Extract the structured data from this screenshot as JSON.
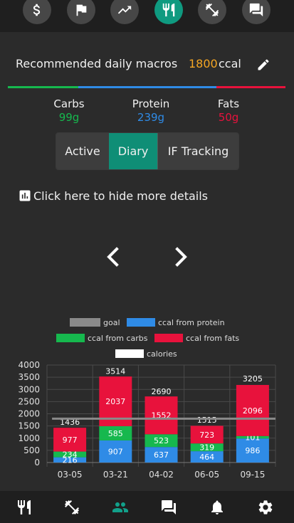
{
  "top_nav": {
    "icons": [
      "dollar-icon",
      "flag-icon",
      "trend-up-icon",
      "fork-knife-icon",
      "dumbbell-icon",
      "chat-icon"
    ],
    "active_index": 3
  },
  "macros": {
    "title": "Recommended daily macros",
    "value": "1800",
    "unit": "ccal"
  },
  "colors": {
    "green": "#16b84e",
    "blue": "#2f8be6",
    "red": "#e8123c",
    "orange": "#f5a623",
    "teal": "#0f8e76"
  },
  "macro_breakdown": [
    {
      "label": "Carbs",
      "value": "99g",
      "color": "#16b84e"
    },
    {
      "label": "Protein",
      "value": "239g",
      "color": "#2f8be6"
    },
    {
      "label": "Fats",
      "value": "50g",
      "color": "#e8123c"
    }
  ],
  "tabs": [
    {
      "label": "Active",
      "selected": false
    },
    {
      "label": "Diary",
      "selected": true
    },
    {
      "label": "IF Tracking",
      "selected": false
    }
  ],
  "details_toggle": {
    "icon": "bar-chart-icon",
    "label": "Click here to hide more details"
  },
  "chart_data": {
    "type": "bar",
    "stacked": true,
    "categories": [
      "03-05",
      "03-21",
      "04-02",
      "06-05",
      "09-15"
    ],
    "series": [
      {
        "name": "ccal from protein",
        "color": "#2f8be6",
        "values": [
          216,
          907,
          637,
          464,
          986
        ]
      },
      {
        "name": "ccal from carbs",
        "color": "#16b84e",
        "values": [
          234,
          585,
          523,
          319,
          101
        ]
      },
      {
        "name": "ccal from fats",
        "color": "#e8123c",
        "values": [
          977,
          2037,
          1552,
          723,
          2096
        ]
      }
    ],
    "calories": [
      1436,
      3514,
      2690,
      1515,
      3205
    ],
    "goal": 1800,
    "legend": [
      {
        "name": "goal",
        "color": "#8a8a8a"
      },
      {
        "name": "ccal from protein",
        "color": "#2f8be6"
      },
      {
        "name": "ccal from carbs",
        "color": "#16b84e"
      },
      {
        "name": "ccal from fats",
        "color": "#e8123c"
      },
      {
        "name": "calories",
        "color": "#ffffff"
      }
    ],
    "y_ticks": [
      0,
      500,
      1000,
      1500,
      2000,
      2500,
      3000,
      3500,
      4000
    ],
    "ylim": [
      0,
      4000
    ],
    "grid": true,
    "legend_position": "top"
  },
  "bottom_nav": {
    "icons": [
      "fork-knife-icon",
      "dumbbell-icon",
      "people-icon",
      "chat-icon",
      "bell-icon",
      "gear-icon"
    ],
    "active_index": 2
  }
}
